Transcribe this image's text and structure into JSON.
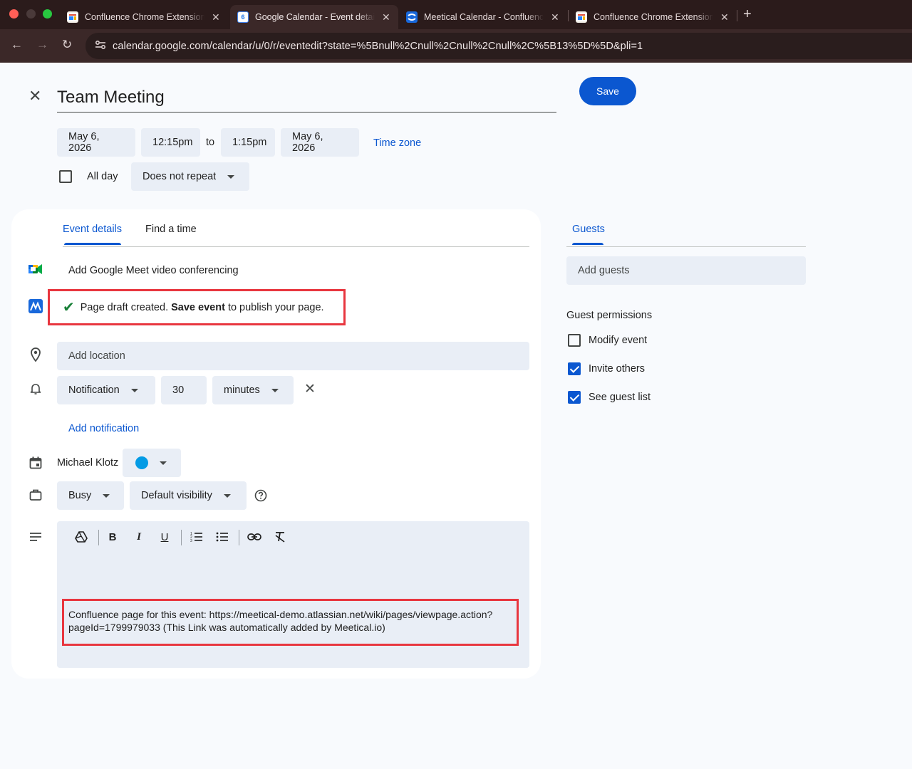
{
  "browser": {
    "tabs": [
      {
        "title": "Confluence Chrome Extension",
        "active": false
      },
      {
        "title": "Google Calendar - Event details",
        "active": true
      },
      {
        "title": "Meetical Calendar - Confluence",
        "active": false
      },
      {
        "title": "Confluence Chrome Extension",
        "active": false
      }
    ],
    "calendar_favicon_text": "6",
    "url": "calendar.google.com/calendar/u/0/r/eventedit?state=%5Bnull%2Cnull%2Cnull%2Cnull%2C%5B13%5D%5D&pli=1"
  },
  "event": {
    "title": "Team Meeting",
    "save_label": "Save",
    "start_date": "May 6, 2026",
    "start_time": "12:15pm",
    "to_label": "to",
    "end_time": "1:15pm",
    "end_date": "May 6, 2026",
    "time_zone_label": "Time zone",
    "all_day_label": "All day",
    "all_day_checked": false,
    "repeat_label": "Does not repeat"
  },
  "details": {
    "tabs": [
      {
        "label": "Event details",
        "active": true
      },
      {
        "label": "Find a time",
        "active": false
      }
    ],
    "meet_label": "Add Google Meet video conferencing",
    "notice_prefix": "Page draft created.",
    "notice_bold": "Save event",
    "notice_suffix": "to publish your page.",
    "location_placeholder": "Add location",
    "notification_type": "Notification",
    "notification_value": "30",
    "notification_unit": "minutes",
    "add_notification_label": "Add notification",
    "calendar_owner": "Michael Klotz",
    "calendar_color": "#039be5",
    "availability": "Busy",
    "visibility": "Default visibility",
    "description_text": "Confluence page for this event: https://meetical-demo.atlassian.net/wiki/pages/viewpage.action?pageId=1799979033 (This Link was automatically added by Meetical.io)"
  },
  "guests": {
    "tab_label": "Guests",
    "add_placeholder": "Add guests",
    "permissions_title": "Guest permissions",
    "permissions": [
      {
        "label": "Modify event",
        "checked": false
      },
      {
        "label": "Invite others",
        "checked": true
      },
      {
        "label": "See guest list",
        "checked": true
      }
    ]
  },
  "colors": {
    "accent": "#0b57d0",
    "highlight_border": "#e8363f",
    "field_bg": "#e9eef6",
    "success": "#188038"
  }
}
